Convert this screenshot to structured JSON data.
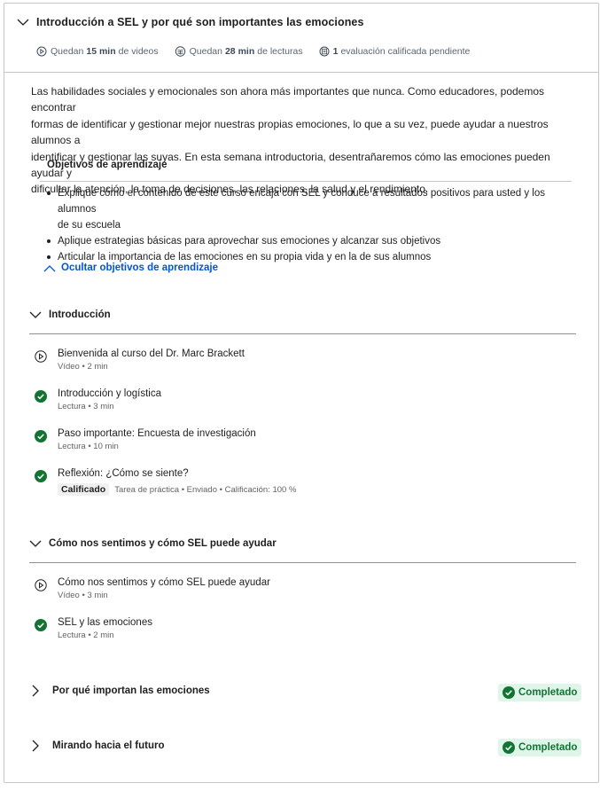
{
  "module": {
    "title": "Introducción a SEL y por qué son importantes las emociones",
    "stats": {
      "videos": {
        "prefix": "Quedan",
        "value": "15 min",
        "suffix": "de videos"
      },
      "readings": {
        "prefix": "Quedan",
        "value": "28 min",
        "suffix": "de lecturas"
      },
      "assessment": {
        "value": "1",
        "suffix": "evaluación calificada pendiente"
      }
    },
    "intro_lines": [
      "Las habilidades sociales y emocionales son ahora más importantes que nunca. Como educadores, podemos encontrar",
      "formas de identificar y gestionar mejor nuestras propias emociones, lo que a su vez, puede ayudar a nuestros alumnos a",
      "identificar y gestionar las suyas. En esta semana introductoria, desentrañaremos cómo las emociones pueden ayudar y",
      "dificultar la atención, la toma de decisiones, las relaciones, la salud y el rendimiento."
    ],
    "objectives_title": "Objetivos de aprendizaje",
    "objectives": [
      "Explique cómo el contenido de este curso encaja con SEL y conduce a resultados positivos para usted y los alumnos de su escuela",
      "Aplique estrategias básicas para aprovechar sus emociones y alcanzar sus objetivos",
      "Articular la importancia de las emociones en su propia vida y en la de sus alumnos"
    ],
    "objectives_line1": "Explique cómo el contenido de este curso encaja con SEL y conduce a resultados positivos para usted y los alumnos",
    "objectives_line1b": "de su escuela",
    "hide_objectives_label": "Ocultar objetivos de aprendizaje"
  },
  "sections": [
    {
      "title": "Introducción",
      "items": [
        {
          "icon": "play-icon",
          "name": "Bienvenida al curso del Dr. Marc Brackett",
          "type": "Vídeo",
          "duration": "2 min"
        },
        {
          "icon": "check-icon",
          "name": "Introducción y logística",
          "type": "Lectura",
          "duration": "3 min"
        },
        {
          "icon": "check-icon",
          "name": "Paso importante: Encuesta de investigación",
          "type": "Lectura",
          "duration": "10 min"
        },
        {
          "icon": "check-icon",
          "name": "Reflexión: ¿Cómo se siente?",
          "graded": "Calificado",
          "type": "Tarea de práctica",
          "status": "Enviado",
          "grade": "Calificación: 100 %"
        }
      ]
    },
    {
      "title": "Cómo nos sentimos y cómo SEL puede ayudar",
      "items": [
        {
          "icon": "play-icon",
          "name": "Cómo nos sentimos y cómo SEL puede ayudar",
          "type": "Vídeo",
          "duration": "3 min"
        },
        {
          "icon": "check-icon",
          "name": "SEL y las emociones",
          "type": "Lectura",
          "duration": "2 min"
        }
      ]
    },
    {
      "title": "Por qué importan las emociones",
      "badge": "Completado"
    },
    {
      "title": "Mirando hacia el futuro",
      "badge": "Completado"
    }
  ],
  "colors": {
    "accent": "#0056d2",
    "success": "#137333",
    "success_bg": "#dff5ea"
  }
}
